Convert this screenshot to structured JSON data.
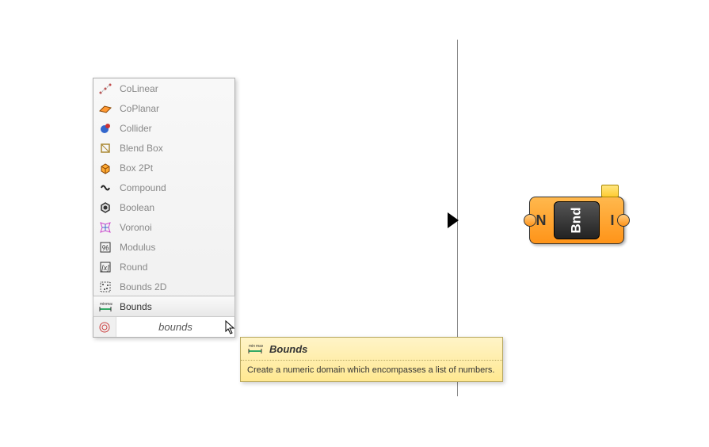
{
  "menu": {
    "items": [
      {
        "label": "CoLinear"
      },
      {
        "label": "CoPlanar"
      },
      {
        "label": "Collider"
      },
      {
        "label": "Blend Box"
      },
      {
        "label": "Box 2Pt"
      },
      {
        "label": "Compound"
      },
      {
        "label": "Boolean"
      },
      {
        "label": "Voronoi"
      },
      {
        "label": "Modulus"
      },
      {
        "label": "Round"
      },
      {
        "label": "Bounds 2D"
      },
      {
        "label": "Bounds"
      }
    ],
    "search_text": "bounds"
  },
  "tooltip": {
    "title": "Bounds",
    "body": "Create a numeric domain which encompasses a list of numbers."
  },
  "node": {
    "left_label": "N",
    "center_label": "Bnd",
    "right_label": "I"
  }
}
